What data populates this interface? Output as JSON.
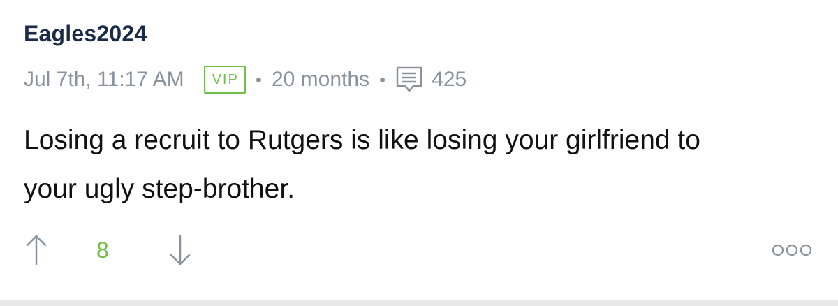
{
  "post": {
    "username": "Eagles2024",
    "timestamp": "Jul 7th, 11:17 AM",
    "badge": "VIP",
    "separator": "•",
    "tenure": "20 months",
    "comment_count": "425",
    "body": "Losing a recruit to Rutgers is like losing your girlfriend to your ugly step-brother.",
    "vote_count": "8"
  },
  "icons": {
    "comment": "comment-icon",
    "upvote": "arrow-up-icon",
    "downvote": "arrow-down-icon",
    "more": "more-options-icon"
  },
  "colors": {
    "username": "#1a2b4a",
    "meta": "#8a939c",
    "vip": "#6fbf4a",
    "vote_count": "#6fbf4a",
    "body": "#111111"
  }
}
